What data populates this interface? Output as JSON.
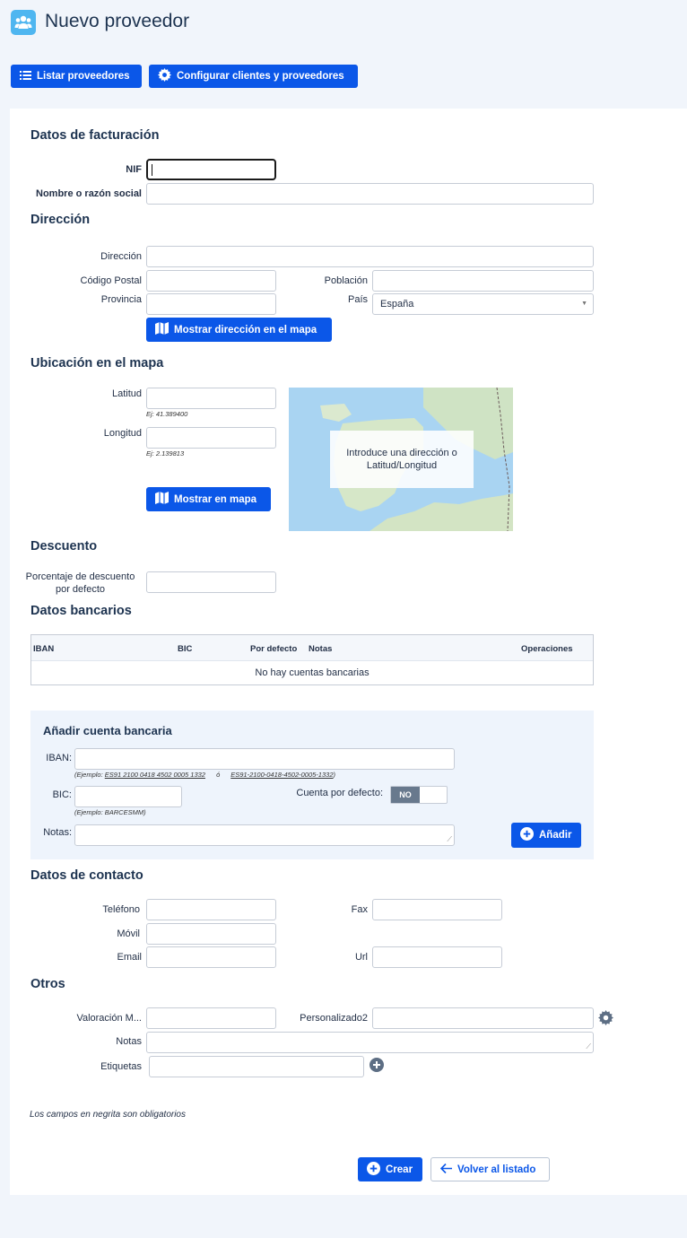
{
  "header": {
    "title": "Nuevo proveedor",
    "icon": "users-icon"
  },
  "toolbar": {
    "list_label": "Listar proveedores",
    "config_label": "Configurar clientes y proveedores"
  },
  "billing": {
    "title": "Datos de facturación",
    "nif_label": "NIF",
    "name_label": "Nombre o razón social"
  },
  "address": {
    "title": "Dirección",
    "address_label": "Dirección",
    "postal_label": "Código Postal",
    "city_label": "Población",
    "province_label": "Provincia",
    "country_label": "País",
    "country_value": "España",
    "map_button": "Mostrar dirección en el mapa"
  },
  "location": {
    "title": "Ubicación en el mapa",
    "lat_label": "Latitud",
    "lat_hint": "Ej: 41.389400",
    "lng_label": "Longitud",
    "lng_hint": "Ej: 2.139813",
    "show_button": "Mostrar en mapa",
    "map_message": "Introduce una dirección o Latitud/Longitud"
  },
  "discount": {
    "title": "Descuento",
    "label_line1": "Porcentaje de descuento",
    "label_line2": "por defecto"
  },
  "bank": {
    "title": "Datos bancarios",
    "columns": [
      "IBAN",
      "BIC",
      "Por defecto",
      "Notas",
      "Operaciones"
    ],
    "empty": "No hay cuentas bancarias",
    "add_title": "Añadir cuenta bancaria",
    "iban_label": "IBAN:",
    "iban_hint_prefix": "(Ejemplo: ",
    "iban_example1": "ES91 2100 0418 4502 0005 1332",
    "iban_hint_or": "ó",
    "iban_example2": "ES91-2100-0418-4502-0005-1332",
    "iban_hint_suffix": ")",
    "bic_label": "BIC:",
    "bic_hint": "(Ejemplo: BARCESMM)",
    "default_label": "Cuenta por defecto:",
    "toggle_value": "NO",
    "notes_label": "Notas:",
    "add_button": "Añadir"
  },
  "contact": {
    "title": "Datos de contacto",
    "phone_label": "Teléfono",
    "fax_label": "Fax",
    "mobile_label": "Móvil",
    "email_label": "Email",
    "url_label": "Url"
  },
  "others": {
    "title": "Otros",
    "rating_label": "Valoración M...",
    "custom_label": "Personalizado2",
    "notes_label": "Notas",
    "tags_label": "Etiquetas"
  },
  "footer": {
    "note": "Los campos en negrita son obligatorios",
    "create_button": "Crear",
    "back_button": "Volver al listado"
  },
  "colors": {
    "primary": "#0b57e8",
    "header_icon": "#4fb6f0",
    "map_water": "#a9d4f2",
    "map_land": "#cfe3c4"
  }
}
